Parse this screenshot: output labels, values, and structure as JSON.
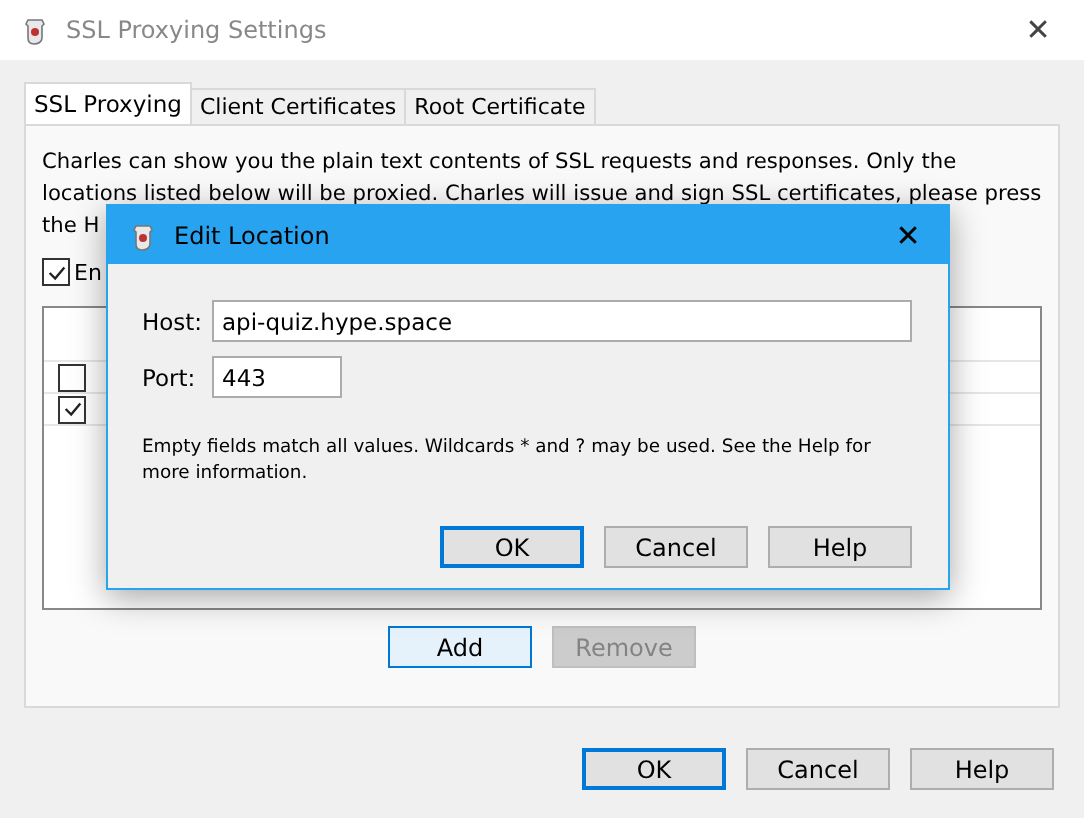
{
  "window": {
    "title": "SSL Proxying Settings",
    "close": "✕"
  },
  "tabs": [
    {
      "label": "SSL Proxying",
      "selected": true
    },
    {
      "label": "Client Certificates",
      "selected": false
    },
    {
      "label": "Root Certificate",
      "selected": false
    }
  ],
  "description": [
    "Charles can show you the plain text contents of SSL requests and responses. Only the",
    "locations listed below will be proxied. Charles will issue and sign SSL certificates, please press",
    "the H"
  ],
  "enable_checkbox": {
    "label": "En",
    "checked": true
  },
  "locations": [
    {
      "enabled": false
    },
    {
      "enabled": true
    }
  ],
  "list_buttons": [
    {
      "label": "Add",
      "disabled": false,
      "focused": true
    },
    {
      "label": "Remove",
      "disabled": true,
      "focused": false
    }
  ],
  "buttons": [
    {
      "label": "OK",
      "focused": true
    },
    {
      "label": "Cancel",
      "focused": false
    },
    {
      "label": "Help",
      "focused": false
    }
  ],
  "dialog": {
    "title": "Edit Location",
    "close": "✕",
    "host_label": "Host:",
    "host": "api-quiz.hype.space",
    "port_label": "Port:",
    "port": "443",
    "hint": "Empty fields match all values. Wildcards * and ? may be used. See the Help for more information.",
    "buttons": [
      {
        "label": "OK",
        "focused": true
      },
      {
        "label": "Cancel",
        "focused": false
      },
      {
        "label": "Help",
        "focused": false
      }
    ]
  }
}
